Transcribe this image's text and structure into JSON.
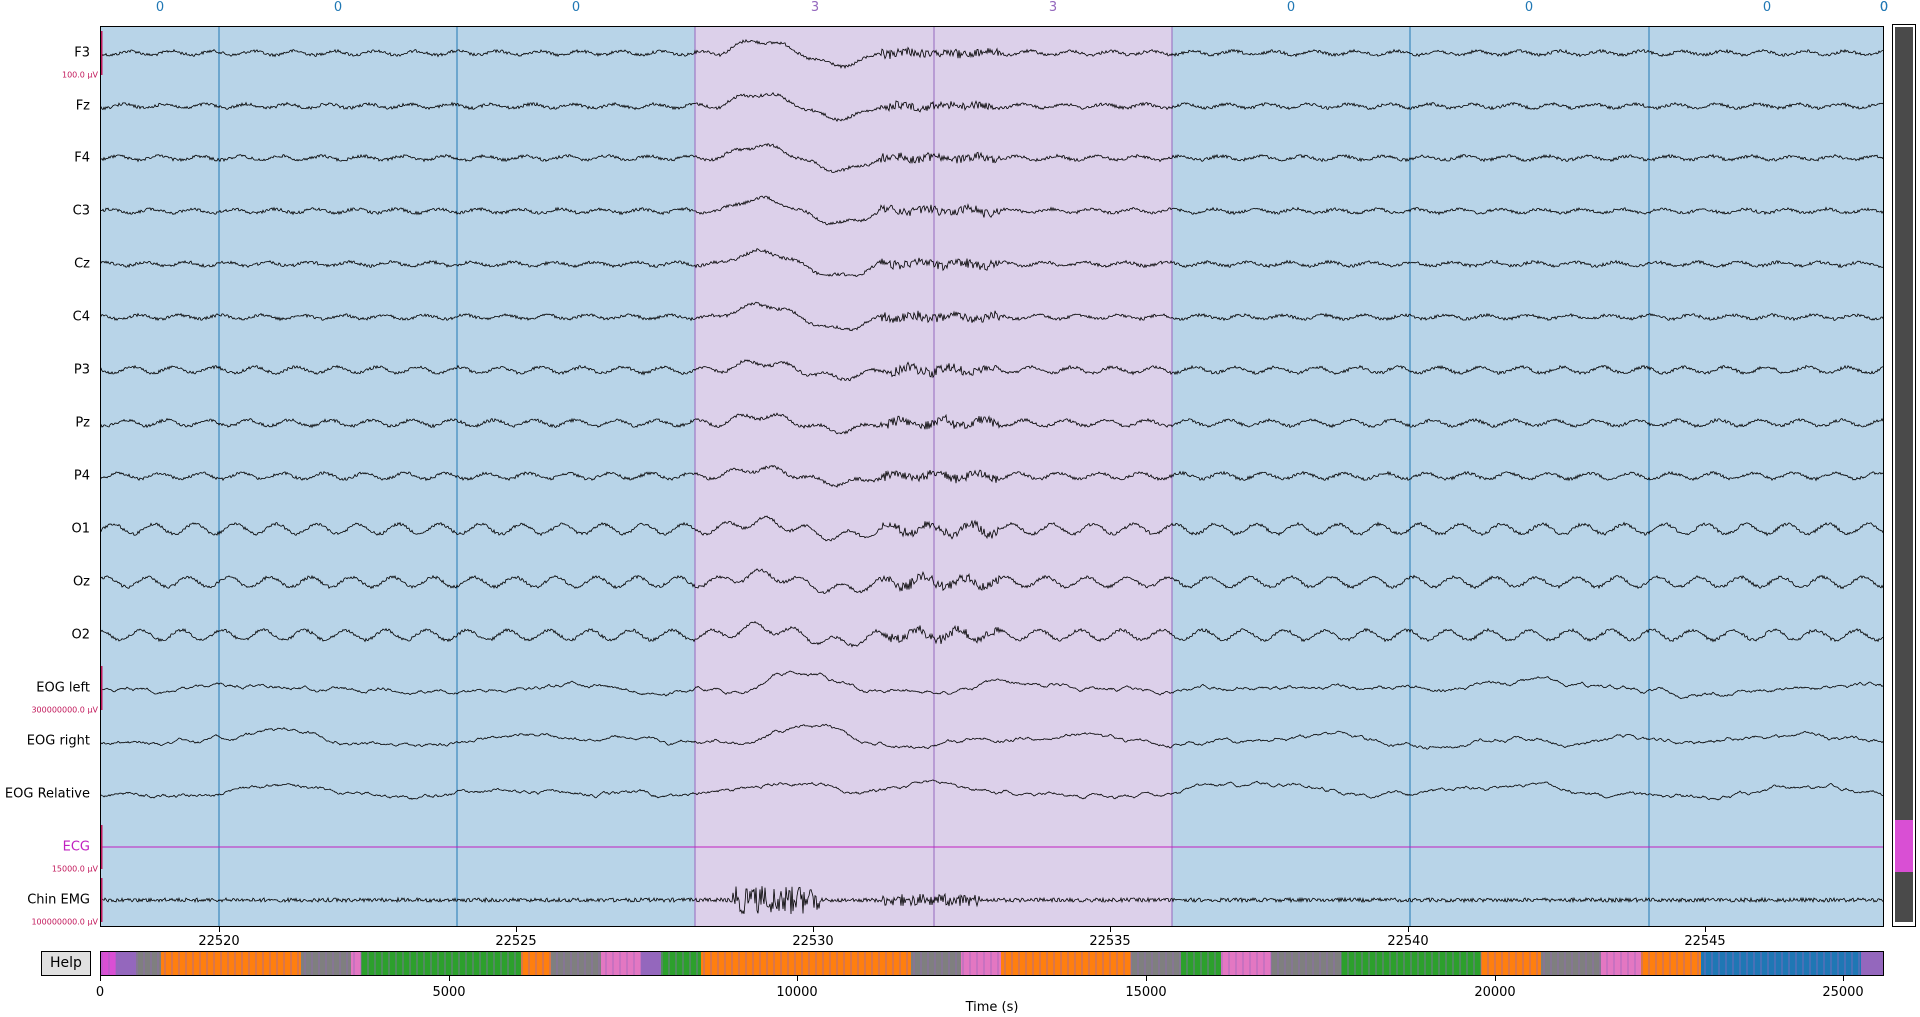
{
  "colors": {
    "stage_0": "#b8d4e8",
    "stage_0_line": "#1f77b4",
    "stage_3": "#dcd0ea",
    "stage_3_line": "#9467bd",
    "trace": "#000000",
    "ecg": "#c020c0",
    "scale_bar": "#c2185b",
    "overview_colors": [
      "#9467bd",
      "#2ca02c",
      "#ff7f0e",
      "#7f7f7f",
      "#e377c2",
      "#1f77b4",
      "#d94fd4"
    ]
  },
  "top_scores": [
    {
      "label": "0",
      "color": "#1f77b4"
    },
    {
      "label": "0",
      "color": "#1f77b4"
    },
    {
      "label": "0",
      "color": "#1f77b4"
    },
    {
      "label": "3",
      "color": "#9467bd"
    },
    {
      "label": "3",
      "color": "#9467bd"
    },
    {
      "label": "0",
      "color": "#1f77b4"
    },
    {
      "label": "0",
      "color": "#1f77b4"
    },
    {
      "label": "0",
      "color": "#1f77b4"
    },
    {
      "label": "0",
      "color": "#1f77b4"
    }
  ],
  "channels": [
    {
      "name": "F3",
      "scale": "100.0 µV"
    },
    {
      "name": "Fz"
    },
    {
      "name": "F4"
    },
    {
      "name": "C3"
    },
    {
      "name": "Cz"
    },
    {
      "name": "C4"
    },
    {
      "name": "P3"
    },
    {
      "name": "Pz"
    },
    {
      "name": "P4"
    },
    {
      "name": "O1"
    },
    {
      "name": "Oz"
    },
    {
      "name": "O2"
    },
    {
      "name": "EOG left",
      "scale": "300000000.0 µV"
    },
    {
      "name": "EOG right"
    },
    {
      "name": "EOG Relative"
    },
    {
      "name": "ECG",
      "scale": "15000.0 µV",
      "color": "#c020c0"
    },
    {
      "name": "Chin EMG",
      "scale": "100000000.0 µV"
    }
  ],
  "x_ticks": [
    "22520",
    "22525",
    "22530",
    "22535",
    "22540",
    "22545"
  ],
  "overview_ticks": [
    "0",
    "5000",
    "10000",
    "15000",
    "20000",
    "25000"
  ],
  "xlabel": "Time (s)",
  "help_label": "Help"
}
